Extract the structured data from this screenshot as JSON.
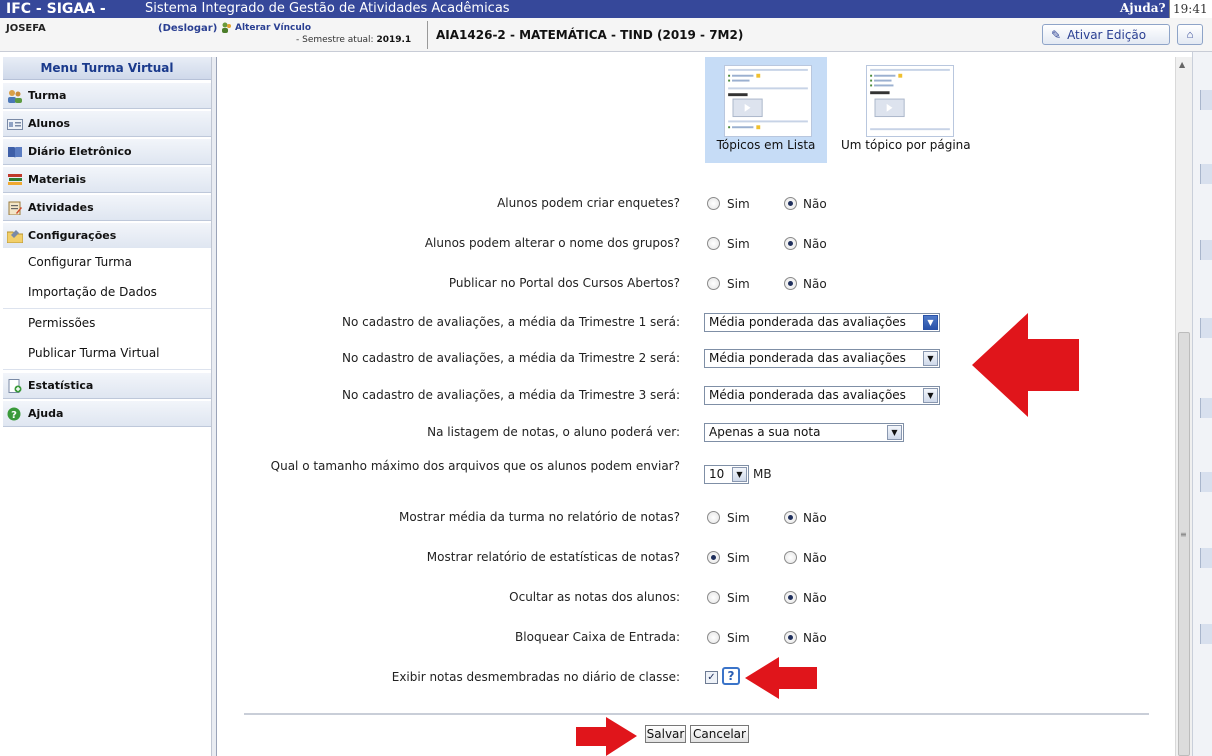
{
  "topbar": {
    "app_name": "IFC - SIGAA -",
    "system_name": "Sistema Integrado de Gestão de Atividades Acadêmicas",
    "help": "Ajuda?",
    "clock": "19:41"
  },
  "infobar": {
    "user": "JOSEFA",
    "logout": "(Deslogar)",
    "change_link": "Alterar Vínculo",
    "semester_label": "- Semestre atual:",
    "semester_value": "2019.1",
    "class_title": "AIA1426-2 - MATEMÁTICA - TIND (2019 - 7M2)",
    "edit_button": "Ativar Edição"
  },
  "sidebar": {
    "title": "Menu Turma Virtual",
    "items": [
      {
        "label": "Turma",
        "icon": "people-icon"
      },
      {
        "label": "Alunos",
        "icon": "id-card-icon"
      },
      {
        "label": "Diário Eletrônico",
        "icon": "book-icon"
      },
      {
        "label": "Materiais",
        "icon": "books-stack-icon"
      },
      {
        "label": "Atividades",
        "icon": "clipboard-icon"
      },
      {
        "label": "Configurações",
        "icon": "folder-settings-icon"
      }
    ],
    "subitems": [
      "Configurar Turma",
      "Importação de Dados",
      "Permissões",
      "Publicar Turma Virtual"
    ],
    "bottom_items": [
      {
        "label": "Estatística",
        "icon": "document-plus-icon"
      },
      {
        "label": "Ajuda",
        "icon": "help-circle-icon"
      }
    ]
  },
  "layout_options": {
    "list": "Tópicos em Lista",
    "paged": "Um tópico por página",
    "selected": "list"
  },
  "form": {
    "yes": "Sim",
    "no": "Não",
    "q_polls": "Alunos podem criar enquetes?",
    "q_polls_value": "Não",
    "q_groups": "Alunos podem alterar o nome dos grupos?",
    "q_groups_value": "Não",
    "q_portal": "Publicar no Portal dos Cursos Abertos?",
    "q_portal_value": "Não",
    "q_tri1": "No cadastro de avaliações, a média da Trimestre 1 será:",
    "q_tri1_value": "Média ponderada das avaliações",
    "q_tri2": "No cadastro de avaliações, a média da Trimestre 2 será:",
    "q_tri2_value": "Média ponderada das avaliações",
    "q_tri3": "No cadastro de avaliações, a média da Trimestre 3 será:",
    "q_tri3_value": "Média ponderada das avaliações",
    "q_grades_view": "Na listagem de notas, o aluno poderá ver:",
    "q_grades_view_value": "Apenas a sua nota",
    "q_max_size": "Qual o tamanho máximo dos arquivos que os alunos podem enviar?",
    "q_max_size_value": "10",
    "q_max_size_unit": "MB",
    "q_avg_report": "Mostrar média da turma no relatório de notas?",
    "q_avg_report_value": "Não",
    "q_stats_report": "Mostrar relatório de estatísticas de notas?",
    "q_stats_report_value": "Sim",
    "q_hide_grades": "Ocultar as notas dos alunos:",
    "q_hide_grades_value": "Não",
    "q_block_inbox": "Bloquear Caixa de Entrada:",
    "q_block_inbox_value": "Não",
    "q_split_grades": "Exibir notas desmembradas no diário de classe:",
    "q_split_grades_checked": true,
    "help_glyph": "?"
  },
  "actions": {
    "save": "Salvar",
    "cancel": "Cancelar"
  },
  "colors": {
    "header_blue": "#36489a",
    "annotation_red": "#e0151b",
    "selected_option": "#c6dcf6"
  }
}
